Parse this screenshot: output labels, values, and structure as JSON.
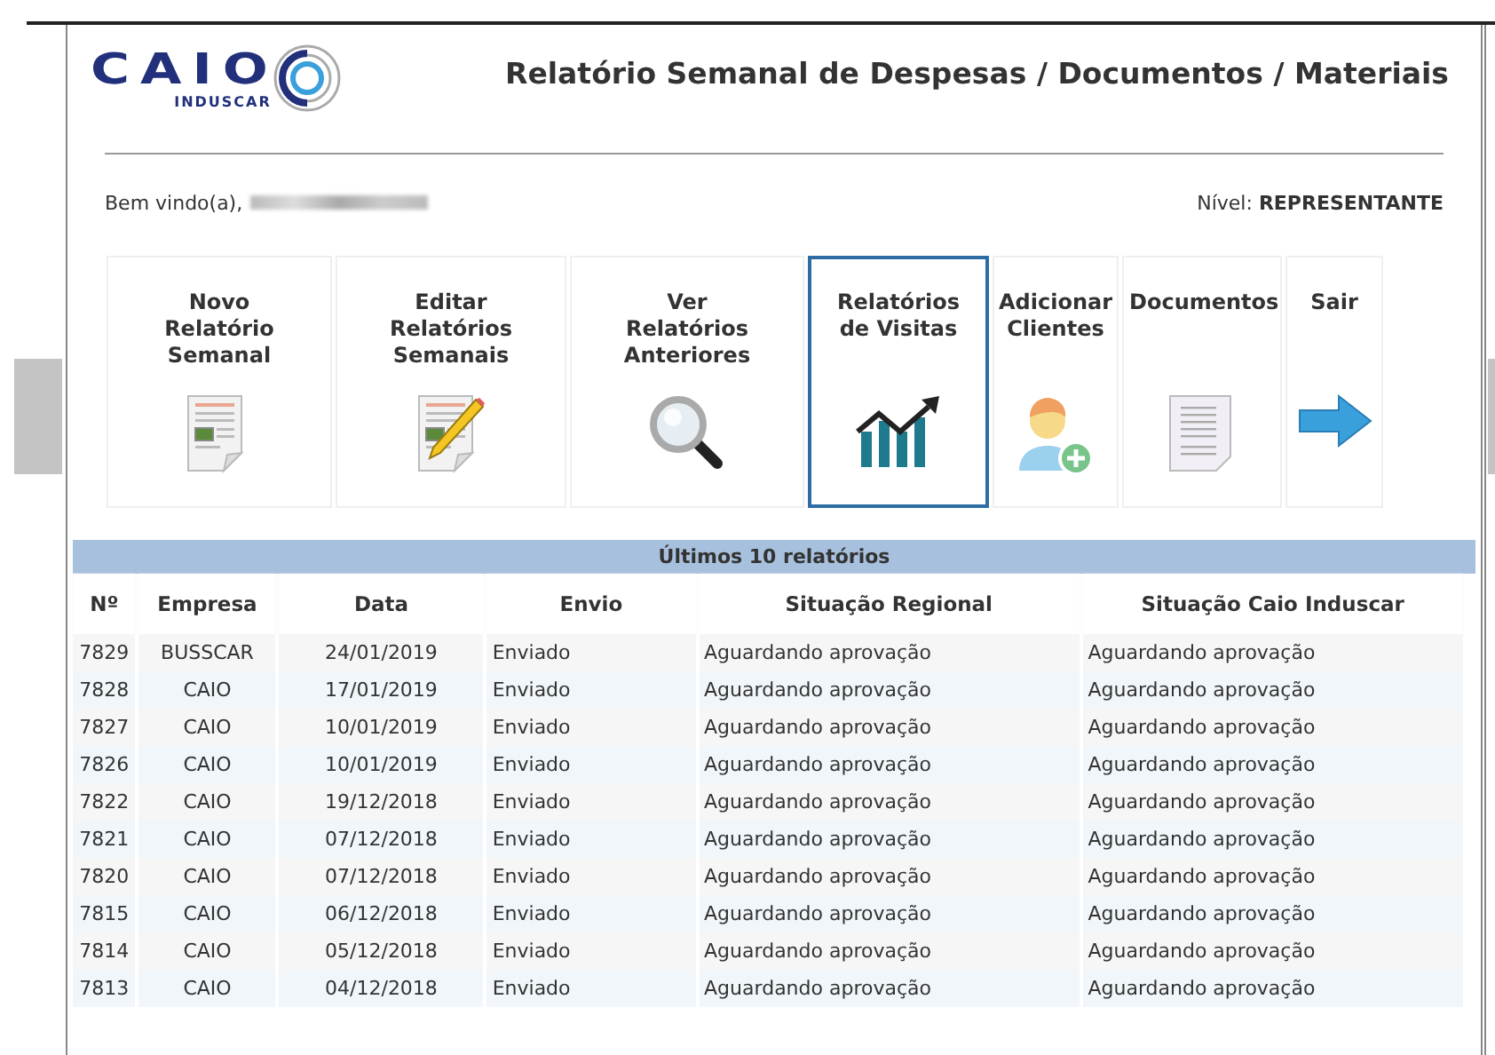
{
  "logo": {
    "name": "CAIO",
    "subtitle": "INDUSCAR"
  },
  "title": "Relatório Semanal de Despesas / Documentos / Materiais",
  "welcome": "Bem vindo(a),",
  "level": {
    "label": "Nível:",
    "value": "REPRESENTANTE"
  },
  "menu": [
    {
      "label": "Novo Relatório Semanal",
      "kind": "new-report",
      "selected": false
    },
    {
      "label": "Editar Relatórios Semanais",
      "kind": "edit-report",
      "selected": false
    },
    {
      "label": "Ver Relatórios Anteriores",
      "kind": "search",
      "selected": false
    },
    {
      "label": "Relatórios de Visitas",
      "kind": "chart",
      "selected": true
    },
    {
      "label": "Adicionar Clientes",
      "kind": "add-user",
      "selected": false
    },
    {
      "label": "Documentos",
      "kind": "document",
      "selected": false
    },
    {
      "label": "Sair",
      "kind": "exit",
      "selected": false
    }
  ],
  "table": {
    "caption": "Últimos 10 relatórios",
    "columns": [
      "Nº",
      "Empresa",
      "Data",
      "Envio",
      "Situação Regional",
      "Situação Caio Induscar"
    ],
    "rows": [
      [
        "7829",
        "BUSSCAR",
        "24/01/2019",
        "Enviado",
        "Aguardando aprovação",
        "Aguardando aprovação"
      ],
      [
        "7828",
        "CAIO",
        "17/01/2019",
        "Enviado",
        "Aguardando aprovação",
        "Aguardando aprovação"
      ],
      [
        "7827",
        "CAIO",
        "10/01/2019",
        "Enviado",
        "Aguardando aprovação",
        "Aguardando aprovação"
      ],
      [
        "7826",
        "CAIO",
        "10/01/2019",
        "Enviado",
        "Aguardando aprovação",
        "Aguardando aprovação"
      ],
      [
        "7822",
        "CAIO",
        "19/12/2018",
        "Enviado",
        "Aguardando aprovação",
        "Aguardando aprovação"
      ],
      [
        "7821",
        "CAIO",
        "07/12/2018",
        "Enviado",
        "Aguardando aprovação",
        "Aguardando aprovação"
      ],
      [
        "7820",
        "CAIO",
        "07/12/2018",
        "Enviado",
        "Aguardando aprovação",
        "Aguardando aprovação"
      ],
      [
        "7815",
        "CAIO",
        "06/12/2018",
        "Enviado",
        "Aguardando aprovação",
        "Aguardando aprovação"
      ],
      [
        "7814",
        "CAIO",
        "05/12/2018",
        "Enviado",
        "Aguardando aprovação",
        "Aguardando aprovação"
      ],
      [
        "7813",
        "CAIO",
        "04/12/2018",
        "Enviado",
        "Aguardando aprovação",
        "Aguardando aprovação"
      ]
    ]
  }
}
